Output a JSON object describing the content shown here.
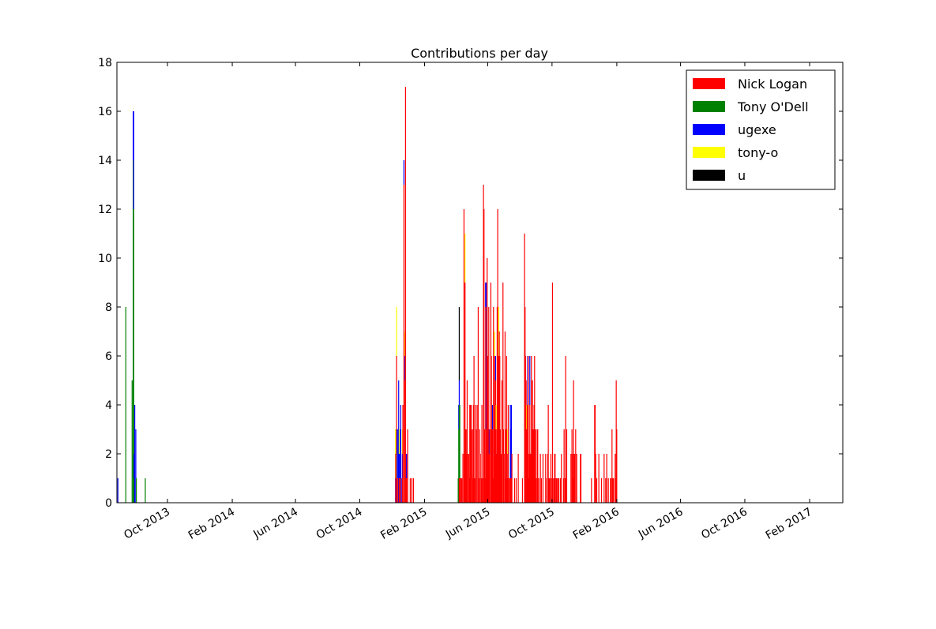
{
  "chart_data": {
    "type": "bar",
    "stacked": true,
    "title": "Contributions per day",
    "xlabel": "",
    "ylabel": "",
    "ylim": [
      0,
      18
    ],
    "yticks": [
      0,
      2,
      4,
      6,
      8,
      10,
      12,
      14,
      16,
      18
    ],
    "xlim": [
      "2013-06-27",
      "2017-04-05"
    ],
    "xticks": [
      {
        "date": "2013-10-01",
        "label": "Oct 2013"
      },
      {
        "date": "2014-02-01",
        "label": "Feb 2014"
      },
      {
        "date": "2014-06-01",
        "label": "Jun 2014"
      },
      {
        "date": "2014-10-01",
        "label": "Oct 2014"
      },
      {
        "date": "2015-02-01",
        "label": "Feb 2015"
      },
      {
        "date": "2015-06-01",
        "label": "Jun 2015"
      },
      {
        "date": "2015-10-01",
        "label": "Oct 2015"
      },
      {
        "date": "2016-02-01",
        "label": "Feb 2016"
      },
      {
        "date": "2016-06-01",
        "label": "Jun 2016"
      },
      {
        "date": "2016-10-01",
        "label": "Oct 2016"
      },
      {
        "date": "2017-02-01",
        "label": "Feb 2017"
      }
    ],
    "legend_position": "top-right",
    "series_names": [
      "Nick Logan",
      "Tony O'Dell",
      "ugexe",
      "tony-o",
      "u"
    ],
    "series_colors": [
      "#ff0000",
      "#008000",
      "#0000ff",
      "#ffff00",
      "#000000"
    ],
    "x_origin": "2013-06-27",
    "days_note": "each entry: [day offset from x_origin, Nick Logan, Tony O'Dell, ugexe, tony-o, u]",
    "days": [
      [
        1,
        0,
        0,
        1,
        0,
        0
      ],
      [
        16,
        0,
        8,
        0,
        0,
        0
      ],
      [
        28,
        0,
        5,
        0,
        0,
        0
      ],
      [
        30,
        0,
        14,
        2,
        0,
        0
      ],
      [
        31,
        0,
        12,
        4,
        0,
        0
      ],
      [
        32,
        0,
        1,
        1,
        0,
        0
      ],
      [
        33,
        0,
        0,
        4,
        0,
        0
      ],
      [
        35,
        0,
        0,
        3,
        0,
        0
      ],
      [
        36,
        0,
        1,
        0,
        0,
        0
      ],
      [
        53,
        0,
        1,
        0,
        0,
        0
      ],
      [
        528,
        2,
        0,
        0,
        1,
        0
      ],
      [
        529,
        0,
        0,
        1,
        2,
        0
      ],
      [
        530,
        6,
        0,
        0,
        2,
        0
      ],
      [
        531,
        1,
        0,
        2,
        0,
        0
      ],
      [
        533,
        1,
        0,
        2,
        0,
        0
      ],
      [
        534,
        0,
        0,
        5,
        0,
        0
      ],
      [
        535,
        1,
        0,
        1,
        1,
        0
      ],
      [
        537,
        1,
        0,
        2,
        0,
        0
      ],
      [
        538,
        1,
        0,
        3,
        0,
        0
      ],
      [
        539,
        0,
        0,
        1,
        0,
        0
      ],
      [
        541,
        1,
        0,
        1,
        1,
        0
      ],
      [
        542,
        4,
        0,
        0,
        0,
        0
      ],
      [
        544,
        13,
        0,
        1,
        0,
        0
      ],
      [
        546,
        5,
        0,
        1,
        1,
        0
      ],
      [
        547,
        17,
        0,
        0,
        0,
        0
      ],
      [
        548,
        2,
        0,
        0,
        0,
        0
      ],
      [
        549,
        1,
        0,
        1,
        0,
        0
      ],
      [
        551,
        3,
        0,
        0,
        0,
        0
      ],
      [
        556,
        1,
        0,
        0,
        0,
        0
      ],
      [
        559,
        1,
        0,
        0,
        0,
        0
      ],
      [
        562,
        1,
        0,
        0,
        0,
        0
      ],
      [
        647,
        0,
        1,
        0,
        0,
        0
      ],
      [
        648,
        0,
        3,
        1,
        0,
        0
      ],
      [
        649,
        1,
        3,
        1,
        0,
        3
      ],
      [
        650,
        1,
        3,
        0,
        0,
        0
      ],
      [
        651,
        1,
        0,
        0,
        0,
        0
      ],
      [
        653,
        1,
        0,
        0,
        0,
        0
      ],
      [
        654,
        1,
        0,
        0,
        0,
        0
      ],
      [
        656,
        2,
        0,
        0,
        0,
        0
      ],
      [
        658,
        12,
        0,
        0,
        0,
        0
      ],
      [
        659,
        2,
        0,
        0,
        0,
        0
      ],
      [
        660,
        9,
        0,
        0,
        2,
        0
      ],
      [
        661,
        3,
        0,
        0,
        0,
        0
      ],
      [
        662,
        2,
        0,
        0,
        0,
        0
      ],
      [
        663,
        3,
        0,
        0,
        0,
        0
      ],
      [
        664,
        5,
        0,
        0,
        0,
        0
      ],
      [
        665,
        2,
        0,
        0,
        0,
        0
      ],
      [
        667,
        2,
        0,
        0,
        0,
        0
      ],
      [
        668,
        1,
        0,
        0,
        0,
        0
      ],
      [
        669,
        4,
        0,
        0,
        0,
        0
      ],
      [
        670,
        4,
        0,
        0,
        0,
        0
      ],
      [
        671,
        3,
        0,
        0,
        0,
        0
      ],
      [
        672,
        4,
        0,
        0,
        0,
        0
      ],
      [
        674,
        3,
        0,
        0,
        0,
        0
      ],
      [
        675,
        1,
        0,
        0,
        0,
        0
      ],
      [
        676,
        4,
        0,
        0,
        0,
        0
      ],
      [
        677,
        6,
        0,
        0,
        0,
        0
      ],
      [
        678,
        1,
        0,
        0,
        0,
        0
      ],
      [
        680,
        4,
        0,
        0,
        0,
        0
      ],
      [
        681,
        3,
        0,
        0,
        0,
        0
      ],
      [
        683,
        4,
        0,
        0,
        0,
        0
      ],
      [
        685,
        8,
        0,
        0,
        0,
        0
      ],
      [
        686,
        1,
        0,
        0,
        0,
        0
      ],
      [
        688,
        3,
        0,
        0,
        0,
        0
      ],
      [
        689,
        2,
        0,
        0,
        0,
        0
      ],
      [
        691,
        1,
        0,
        0,
        0,
        0
      ],
      [
        692,
        4,
        0,
        0,
        0,
        0
      ],
      [
        693,
        1,
        0,
        0,
        0,
        0
      ],
      [
        695,
        13,
        0,
        0,
        0,
        0
      ],
      [
        696,
        12,
        0,
        0,
        0,
        0
      ],
      [
        697,
        3,
        0,
        0,
        0,
        0
      ],
      [
        698,
        1,
        0,
        0,
        0,
        0
      ],
      [
        699,
        8,
        0,
        1,
        0,
        0
      ],
      [
        700,
        3,
        0,
        6,
        0,
        0
      ],
      [
        701,
        8,
        0,
        0,
        0,
        0
      ],
      [
        702,
        10,
        0,
        0,
        0,
        0
      ],
      [
        703,
        6,
        0,
        0,
        0,
        0
      ],
      [
        704,
        3,
        0,
        0,
        0,
        0
      ],
      [
        705,
        8,
        0,
        0,
        0,
        0
      ],
      [
        706,
        2,
        0,
        1,
        0,
        0
      ],
      [
        707,
        3,
        0,
        0,
        0,
        0
      ],
      [
        709,
        9,
        0,
        0,
        0,
        0
      ],
      [
        710,
        6,
        0,
        0,
        0,
        0
      ],
      [
        711,
        3,
        0,
        0,
        0,
        0
      ],
      [
        712,
        3,
        0,
        1,
        0,
        0
      ],
      [
        713,
        1,
        0,
        0,
        0,
        0
      ],
      [
        714,
        8,
        0,
        0,
        0,
        0
      ],
      [
        715,
        3,
        0,
        0,
        0,
        0
      ],
      [
        716,
        6,
        0,
        0,
        1,
        0
      ],
      [
        717,
        4,
        0,
        0,
        0,
        0
      ],
      [
        718,
        5,
        0,
        1,
        0,
        0
      ],
      [
        719,
        3,
        0,
        0,
        1,
        0
      ],
      [
        720,
        2,
        0,
        0,
        0,
        0
      ],
      [
        721,
        8,
        0,
        0,
        0,
        0
      ],
      [
        722,
        12,
        0,
        0,
        0,
        0
      ],
      [
        723,
        6,
        0,
        0,
        0,
        0
      ],
      [
        724,
        6,
        0,
        0,
        2,
        0
      ],
      [
        725,
        7,
        0,
        0,
        0,
        0
      ],
      [
        726,
        6,
        0,
        0,
        0,
        0
      ],
      [
        727,
        3,
        0,
        0,
        0,
        0
      ],
      [
        728,
        2,
        0,
        0,
        0,
        0
      ],
      [
        729,
        2,
        0,
        0,
        0,
        0
      ],
      [
        730,
        5,
        0,
        0,
        0,
        0
      ],
      [
        732,
        9,
        0,
        0,
        0,
        0
      ],
      [
        733,
        3,
        0,
        0,
        0,
        0
      ],
      [
        734,
        2,
        0,
        0,
        0,
        0
      ],
      [
        736,
        7,
        0,
        0,
        0,
        0
      ],
      [
        737,
        1,
        0,
        0,
        0,
        0
      ],
      [
        738,
        3,
        0,
        0,
        0,
        0
      ],
      [
        739,
        6,
        0,
        0,
        0,
        0
      ],
      [
        740,
        1,
        0,
        0,
        0,
        0
      ],
      [
        741,
        2,
        0,
        0,
        1,
        0
      ],
      [
        742,
        4,
        0,
        0,
        0,
        0
      ],
      [
        743,
        1,
        0,
        0,
        0,
        0
      ],
      [
        745,
        1,
        0,
        0,
        0,
        0
      ],
      [
        746,
        1,
        0,
        3,
        0,
        0
      ],
      [
        747,
        1,
        0,
        2,
        0,
        0
      ],
      [
        748,
        1,
        0,
        3,
        0,
        0
      ],
      [
        749,
        2,
        0,
        0,
        0,
        0
      ],
      [
        754,
        1,
        0,
        0,
        0,
        0
      ],
      [
        757,
        1,
        0,
        0,
        0,
        0
      ],
      [
        761,
        2,
        0,
        0,
        0,
        0
      ],
      [
        769,
        1,
        0,
        0,
        0,
        0
      ],
      [
        773,
        11,
        0,
        0,
        0,
        0
      ],
      [
        774,
        8,
        0,
        0,
        0,
        0
      ],
      [
        775,
        6,
        0,
        0,
        0,
        0
      ],
      [
        776,
        5,
        0,
        0,
        0,
        0
      ],
      [
        777,
        3,
        0,
        0,
        1,
        0
      ],
      [
        778,
        4,
        0,
        0,
        0,
        0
      ],
      [
        779,
        4,
        0,
        2,
        0,
        0
      ],
      [
        780,
        6,
        0,
        0,
        0,
        0
      ],
      [
        781,
        1,
        0,
        0,
        0,
        0
      ],
      [
        782,
        2,
        0,
        0,
        0,
        0
      ],
      [
        783,
        4,
        0,
        2,
        0,
        0
      ],
      [
        784,
        2,
        0,
        0,
        0,
        0
      ],
      [
        785,
        2,
        0,
        0,
        0,
        0
      ],
      [
        786,
        6,
        0,
        0,
        0,
        0
      ],
      [
        787,
        3,
        0,
        0,
        0,
        0
      ],
      [
        788,
        5,
        0,
        0,
        0,
        0
      ],
      [
        789,
        3,
        0,
        0,
        0,
        0
      ],
      [
        790,
        3,
        0,
        0,
        0,
        0
      ],
      [
        791,
        4,
        0,
        0,
        0,
        0
      ],
      [
        792,
        6,
        0,
        0,
        0,
        0
      ],
      [
        793,
        3,
        0,
        0,
        0,
        0
      ],
      [
        794,
        3,
        0,
        0,
        0,
        0
      ],
      [
        795,
        1,
        0,
        0,
        0,
        0
      ],
      [
        797,
        3,
        0,
        0,
        0,
        0
      ],
      [
        798,
        3,
        0,
        0,
        0,
        0
      ],
      [
        800,
        1,
        0,
        0,
        0,
        0
      ],
      [
        803,
        2,
        0,
        0,
        0,
        0
      ],
      [
        805,
        1,
        0,
        0,
        0,
        0
      ],
      [
        808,
        2,
        0,
        0,
        0,
        0
      ],
      [
        813,
        2,
        0,
        0,
        0,
        0
      ],
      [
        814,
        1,
        0,
        0,
        0,
        0
      ],
      [
        817,
        2,
        0,
        0,
        0,
        0
      ],
      [
        818,
        4,
        0,
        0,
        0,
        0
      ],
      [
        819,
        1,
        0,
        0,
        0,
        0
      ],
      [
        820,
        1,
        0,
        0,
        0,
        0
      ],
      [
        821,
        1,
        0,
        0,
        0,
        0
      ],
      [
        823,
        2,
        0,
        0,
        0,
        0
      ],
      [
        825,
        1,
        0,
        0,
        0,
        0
      ],
      [
        826,
        9,
        0,
        0,
        0,
        0
      ],
      [
        827,
        1,
        0,
        0,
        0,
        0
      ],
      [
        829,
        1,
        0,
        0,
        0,
        0
      ],
      [
        830,
        2,
        0,
        0,
        0,
        0
      ],
      [
        831,
        2,
        0,
        0,
        0,
        0
      ],
      [
        833,
        1,
        0,
        0,
        0,
        0
      ],
      [
        834,
        1,
        0,
        0,
        0,
        0
      ],
      [
        836,
        1,
        0,
        0,
        0,
        0
      ],
      [
        838,
        1,
        0,
        0,
        0,
        0
      ],
      [
        841,
        1,
        0,
        0,
        0,
        0
      ],
      [
        843,
        2,
        0,
        0,
        0,
        0
      ],
      [
        847,
        1,
        0,
        0,
        0,
        0
      ],
      [
        848,
        3,
        0,
        0,
        0,
        0
      ],
      [
        850,
        1,
        0,
        0,
        0,
        0
      ],
      [
        851,
        6,
        0,
        0,
        0,
        0
      ],
      [
        852,
        1,
        0,
        0,
        0,
        0
      ],
      [
        853,
        3,
        0,
        0,
        0,
        0
      ],
      [
        861,
        2,
        0,
        0,
        0,
        0
      ],
      [
        863,
        3,
        0,
        0,
        0,
        0
      ],
      [
        864,
        2,
        0,
        0,
        0,
        0
      ],
      [
        865,
        1,
        0,
        0,
        0,
        0
      ],
      [
        866,
        5,
        0,
        0,
        0,
        0
      ],
      [
        867,
        2,
        0,
        0,
        0,
        0
      ],
      [
        868,
        2,
        0,
        0,
        0,
        0
      ],
      [
        870,
        3,
        0,
        0,
        0,
        0
      ],
      [
        872,
        2,
        0,
        0,
        0,
        0
      ],
      [
        879,
        2,
        0,
        0,
        0,
        0
      ],
      [
        880,
        2,
        0,
        0,
        0,
        0
      ],
      [
        900,
        1,
        0,
        0,
        0,
        0
      ],
      [
        906,
        4,
        0,
        0,
        0,
        0
      ],
      [
        907,
        4,
        0,
        0,
        0,
        0
      ],
      [
        908,
        2,
        0,
        0,
        0,
        0
      ],
      [
        910,
        1,
        0,
        0,
        0,
        0
      ],
      [
        914,
        2,
        0,
        0,
        0,
        0
      ],
      [
        919,
        1,
        0,
        0,
        0,
        0
      ],
      [
        924,
        2,
        0,
        0,
        0,
        0
      ],
      [
        927,
        1,
        0,
        0,
        0,
        0
      ],
      [
        929,
        2,
        0,
        0,
        0,
        0
      ],
      [
        932,
        1,
        0,
        0,
        0,
        0
      ],
      [
        936,
        1,
        0,
        0,
        0,
        0
      ],
      [
        937,
        1,
        0,
        0,
        0,
        0
      ],
      [
        939,
        3,
        0,
        0,
        0,
        0
      ],
      [
        940,
        1,
        0,
        0,
        0,
        0
      ],
      [
        941,
        1,
        0,
        0,
        0,
        0
      ],
      [
        942,
        1,
        0,
        0,
        0,
        0
      ],
      [
        945,
        2,
        0,
        0,
        0,
        0
      ],
      [
        946,
        1,
        0,
        0,
        0,
        0
      ],
      [
        947,
        5,
        0,
        0,
        0,
        0
      ],
      [
        948,
        3,
        0,
        0,
        0,
        0
      ]
    ]
  }
}
